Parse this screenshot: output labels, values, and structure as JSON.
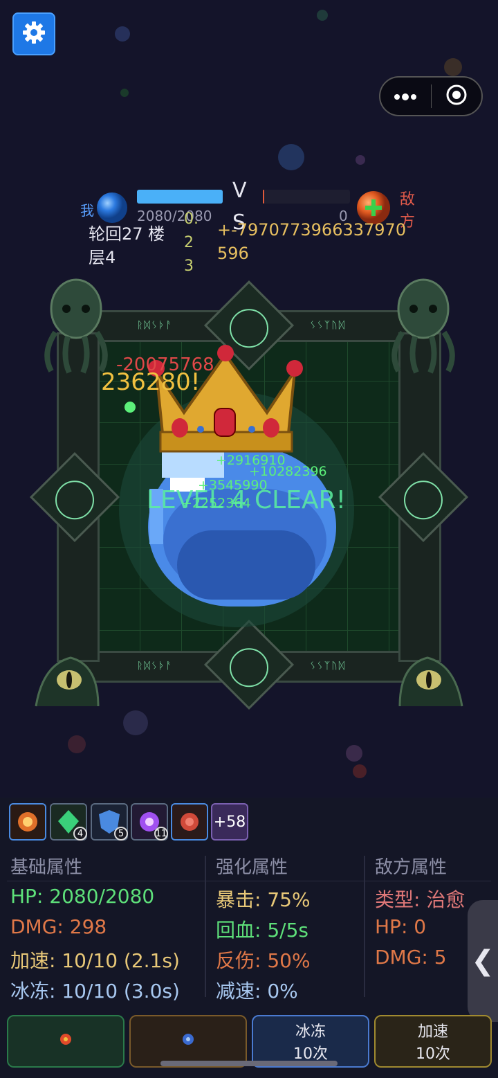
{
  "top": {
    "settings_icon": "gear-icon",
    "capsule": {
      "more_icon": "more-dots-icon",
      "close_icon": "target-close-icon"
    }
  },
  "vs": {
    "player_label": "我",
    "player_hp": "2080/2080",
    "player_hp_fraction": 1.0,
    "vs_v": "V",
    "vs_s": "S",
    "enemy_hp": "0",
    "enemy_hp_fraction": 0,
    "enemy_label_1": "敌",
    "enemy_label_2": "方",
    "round_line1": "轮回27 楼",
    "round_line2": "层4",
    "time_1": "0.",
    "time_2": "2",
    "time_3": "3",
    "score_line1": "+-7970773966337970",
    "score_line2": "596"
  },
  "arena": {
    "runes_top_left": "ᚱᛞᛊᚦᚨ",
    "runes_top_right": "ᛊᛊᛉᚢᛞ",
    "runes_bottom_left": "ᚱᛞᛊᚦᚨ",
    "runes_bottom_right": "ᛊᛊᛉᚢᛞ",
    "float_red": "-20075768",
    "float_gold": "236280!",
    "float_green_1": "+2916910",
    "float_green_2": "+10282396",
    "float_green_3": "+3545990",
    "float_green_4": "+2252364",
    "banner": "LEVEL 4 CLEAR!"
  },
  "buffs": {
    "items": [
      {
        "icon": "fire-swirl-icon",
        "count": ""
      },
      {
        "icon": "green-crystal-icon",
        "count": "4"
      },
      {
        "icon": "blue-shield-icon",
        "count": "5"
      },
      {
        "icon": "purple-orb-icon",
        "count": "11"
      },
      {
        "icon": "red-rose-icon",
        "count": ""
      }
    ],
    "more": "+58"
  },
  "stats": {
    "basic_title": "基础属性",
    "basic": [
      "HP: 2080/2080",
      "DMG: 298",
      "加速: 10/10 (2.1s)",
      "冰冻: 10/10 (3.0s)"
    ],
    "enhance_title": "强化属性",
    "enhance": [
      "暴击: 75%",
      "回血: 5/5s",
      "反伤: 50%",
      "减速: 0%"
    ],
    "enemy_title": "敌方属性",
    "enemy": [
      "类型: 治愈",
      "HP: 0",
      "DMG: 5"
    ],
    "collapse_icon": "chevron-left-icon",
    "collapse_label": "❮",
    "colors": {
      "hp": "#5ee07a",
      "dmg": "#e07848",
      "speed": "#e8c878",
      "freeze": "#a8c8f0",
      "crit": "#e8c878",
      "regen": "#5ee07a",
      "reflect": "#e07848",
      "slow": "#a8c8f0",
      "enemy_type": "#e07878"
    }
  },
  "buttons": {
    "btn1_icon": "fire-gem-icon",
    "btn2_icon": "blue-gem-icon",
    "freeze_label": "冰冻",
    "freeze_count": "10次",
    "speed_label": "加速",
    "speed_count": "10次"
  }
}
